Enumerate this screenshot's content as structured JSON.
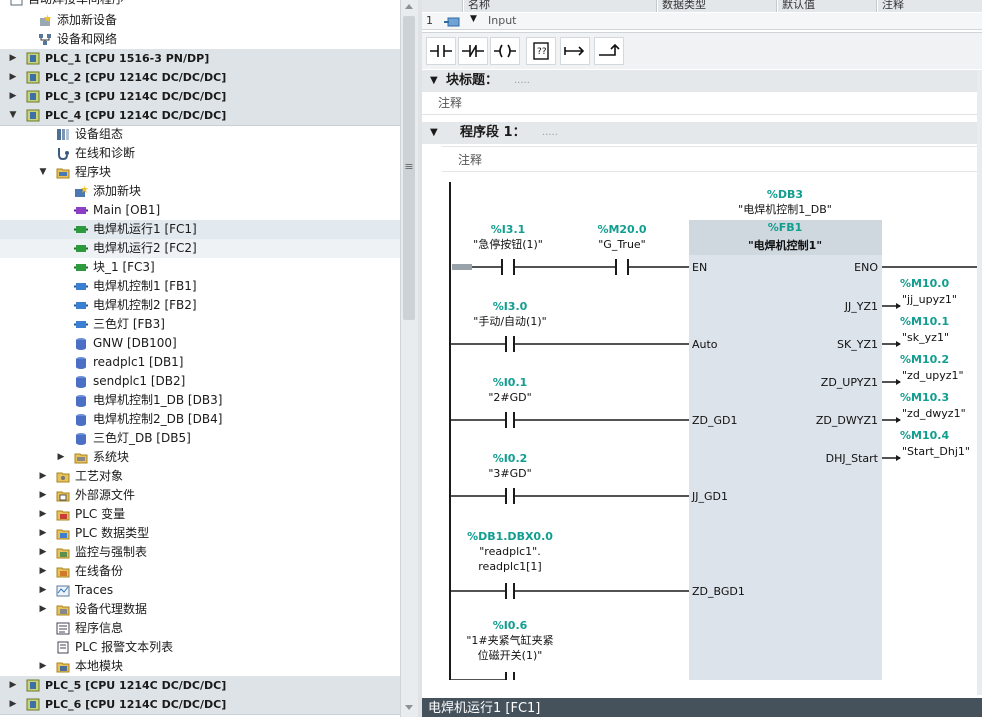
{
  "tree": {
    "top_item": "自动焊接车间程序",
    "items": [
      {
        "label": "添加新设备",
        "icon": "add-device-icon",
        "indent": 1,
        "arrow": ""
      },
      {
        "label": "设备和网络",
        "icon": "network-icon",
        "indent": 1,
        "arrow": ""
      },
      {
        "label": "PLC_1 [CPU 1516-3 PN/DP]",
        "icon": "cpu-icon",
        "indent": 0,
        "arrow": "right",
        "kind": "plc"
      },
      {
        "label": "PLC_2 [CPU 1214C DC/DC/DC]",
        "icon": "cpu-icon",
        "indent": 0,
        "arrow": "right",
        "kind": "plc"
      },
      {
        "label": "PLC_3 [CPU 1214C DC/DC/DC]",
        "icon": "cpu-icon",
        "indent": 0,
        "arrow": "right",
        "kind": "plc"
      },
      {
        "label": "PLC_4 [CPU 1214C DC/DC/DC]",
        "icon": "cpu-icon",
        "indent": 0,
        "arrow": "down",
        "kind": "plc"
      },
      {
        "label": "设备组态",
        "icon": "device-config-icon",
        "indent": 2,
        "arrow": ""
      },
      {
        "label": "在线和诊断",
        "icon": "diagnostics-icon",
        "indent": 2,
        "arrow": ""
      },
      {
        "label": "程序块",
        "icon": "folder-icon",
        "indent": 2,
        "arrow": "down"
      },
      {
        "label": "添加新块",
        "icon": "add-block-icon",
        "indent": 3,
        "arrow": ""
      },
      {
        "label": "Main [OB1]",
        "icon": "ob-block-icon",
        "indent": 3,
        "arrow": ""
      },
      {
        "label": "电焊机运行1 [FC1]",
        "icon": "fc-block-icon",
        "indent": 3,
        "arrow": "",
        "kind": "sel"
      },
      {
        "label": "电焊机运行2 [FC2]",
        "icon": "fc-block-icon",
        "indent": 3,
        "arrow": "",
        "kind": "hov"
      },
      {
        "label": "块_1 [FC3]",
        "icon": "fc-block-icon",
        "indent": 3,
        "arrow": ""
      },
      {
        "label": "电焊机控制1 [FB1]",
        "icon": "fb-block-icon",
        "indent": 3,
        "arrow": ""
      },
      {
        "label": "电焊机控制2 [FB2]",
        "icon": "fb-block-icon",
        "indent": 3,
        "arrow": ""
      },
      {
        "label": "三色灯 [FB3]",
        "icon": "fb-block-icon",
        "indent": 3,
        "arrow": ""
      },
      {
        "label": "GNW [DB100]",
        "icon": "db-block-icon",
        "indent": 3,
        "arrow": ""
      },
      {
        "label": "readplc1 [DB1]",
        "icon": "db-block-icon",
        "indent": 3,
        "arrow": ""
      },
      {
        "label": "sendplc1 [DB2]",
        "icon": "db-block-icon",
        "indent": 3,
        "arrow": ""
      },
      {
        "label": "电焊机控制1_DB [DB3]",
        "icon": "db-block-icon",
        "indent": 3,
        "arrow": ""
      },
      {
        "label": "电焊机控制2_DB [DB4]",
        "icon": "db-block-icon",
        "indent": 3,
        "arrow": ""
      },
      {
        "label": "三色灯_DB [DB5]",
        "icon": "db-block-icon",
        "indent": 3,
        "arrow": ""
      },
      {
        "label": "系统块",
        "icon": "system-block-icon",
        "indent": 3,
        "arrow": "right"
      },
      {
        "label": "工艺对象",
        "icon": "tech-object-icon",
        "indent": 2,
        "arrow": "right"
      },
      {
        "label": "外部源文件",
        "icon": "source-file-icon",
        "indent": 2,
        "arrow": "right"
      },
      {
        "label": "PLC 变量",
        "icon": "tag-table-icon",
        "indent": 2,
        "arrow": "right"
      },
      {
        "label": "PLC 数据类型",
        "icon": "data-type-icon",
        "indent": 2,
        "arrow": "right"
      },
      {
        "label": "监控与强制表",
        "icon": "watch-table-icon",
        "indent": 2,
        "arrow": "right"
      },
      {
        "label": "在线备份",
        "icon": "backup-icon",
        "indent": 2,
        "arrow": "right"
      },
      {
        "label": "Traces",
        "icon": "traces-icon",
        "indent": 2,
        "arrow": "right"
      },
      {
        "label": "设备代理数据",
        "icon": "proxy-data-icon",
        "indent": 2,
        "arrow": "right"
      },
      {
        "label": "程序信息",
        "icon": "program-info-icon",
        "indent": 2,
        "arrow": ""
      },
      {
        "label": "PLC 报警文本列表",
        "icon": "alarm-text-icon",
        "indent": 2,
        "arrow": ""
      },
      {
        "label": "本地模块",
        "icon": "local-module-icon",
        "indent": 2,
        "arrow": "right"
      },
      {
        "label": "PLC_5 [CPU 1214C DC/DC/DC]",
        "icon": "cpu-icon",
        "indent": 0,
        "arrow": "right",
        "kind": "plc"
      },
      {
        "label": "PLC_6 [CPU 1214C DC/DC/DC]",
        "icon": "cpu-icon",
        "indent": 0,
        "arrow": "right",
        "kind": "plc"
      }
    ]
  },
  "interface": {
    "headers": {
      "name": "名称",
      "datatype": "数据类型",
      "default": "默认值",
      "comment": "注释"
    },
    "row_num": "1",
    "row_name": "Input"
  },
  "toolbar": {
    "buttons": [
      "no-contact",
      "nc-contact",
      "coil",
      "empty-box",
      "open-branch",
      "close-branch"
    ]
  },
  "block": {
    "title_label": "块标题：",
    "title_dots": ".....",
    "comment": "注释"
  },
  "network": {
    "label": "程序段 1：",
    "dots": ".....",
    "comment": "注释"
  },
  "ladder": {
    "db_addr": "%DB3",
    "db_name": "\"电焊机控制1_DB\"",
    "fb_addr": "%FB1",
    "fb_name": "\"电焊机控制1\"",
    "en": "EN",
    "eno": "ENO",
    "contacts": [
      {
        "addr": "%I3.1",
        "name": "\"急停按钮(1)\""
      },
      {
        "addr": "%M20.0",
        "name": "\"G_True\""
      },
      {
        "addr": "%I3.0",
        "name": "\"手动/自动(1)\""
      },
      {
        "addr": "%I0.1",
        "name": "\"2#GD\""
      },
      {
        "addr": "%I0.2",
        "name": "\"3#GD\""
      },
      {
        "addr": "%DB1.DBX0.0",
        "name": "\"readplc1\".",
        "name2": "readplc1[1]"
      },
      {
        "addr": "%I0.6",
        "name": "\"1#夹紧气缸夹紧",
        "name2": "位磁开关(1)\""
      }
    ],
    "inputs": [
      "Auto",
      "ZD_GD1",
      "JJ_GD1",
      "ZD_BGD1"
    ],
    "outputs": [
      {
        "pin": "JJ_YZ1",
        "addr": "%M10.0",
        "name": "\"jj_upyz1\""
      },
      {
        "pin": "SK_YZ1",
        "addr": "%M10.1",
        "name": "\"sk_yz1\""
      },
      {
        "pin": "ZD_UPYZ1",
        "addr": "%M10.2",
        "name": "\"zd_upyz1\""
      },
      {
        "pin": "ZD_DWYZ1",
        "addr": "%M10.3",
        "name": "\"zd_dwyz1\""
      },
      {
        "pin": "DHJ_Start",
        "addr": "%M10.4",
        "name": "\"Start_Dhj1\""
      }
    ],
    "colors": {
      "addr": "#129e8f",
      "box": "#dde3ea",
      "wire": "#1a1a1a"
    }
  },
  "bottom_tab": "电焊机运行1 [FC1]"
}
